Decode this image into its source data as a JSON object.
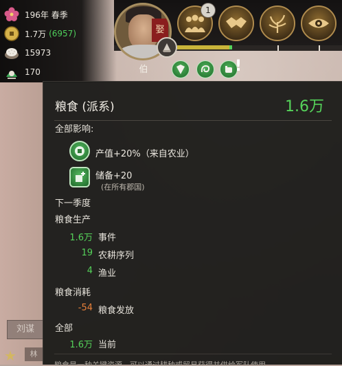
{
  "stats": {
    "date": "196年 春季",
    "money": "1.7万",
    "money_income": "(6957)",
    "food": "15973",
    "population": "170"
  },
  "topbar": {
    "rank_label": "伯",
    "notification_count": "1",
    "portrait_sign": "娶"
  },
  "map": {
    "city_label": "刘谋",
    "city_label_2": "林"
  },
  "tooltip": {
    "title": "粮食 (派系)",
    "total": "1.6万",
    "all_effects_label": "全部影响:",
    "influences": [
      {
        "text": "产值+20%（来自农业）"
      },
      {
        "text": "储备+20",
        "sub": "(在所有郡国)"
      }
    ],
    "next_season_label": "下一季度",
    "production_label": "粮食生产",
    "production_rows": [
      {
        "value": "1.6万",
        "label": "事件"
      },
      {
        "value": "19",
        "label": "农耕序列"
      },
      {
        "value": "4",
        "label": "渔业"
      }
    ],
    "consumption_label": "粮食消耗",
    "consumption_rows": [
      {
        "value": "-54",
        "label": "粮食发放"
      }
    ],
    "total_label": "全部",
    "total_rows": [
      {
        "value": "1.6万",
        "label": "当前"
      }
    ],
    "footer_text": "粮食是一种关键资源，可以通过耕种或贸易获得并供给军队使用"
  },
  "colors": {
    "positive": "#55d35a",
    "negative": "#e8803a",
    "panel_bg": "#1a1a18"
  }
}
